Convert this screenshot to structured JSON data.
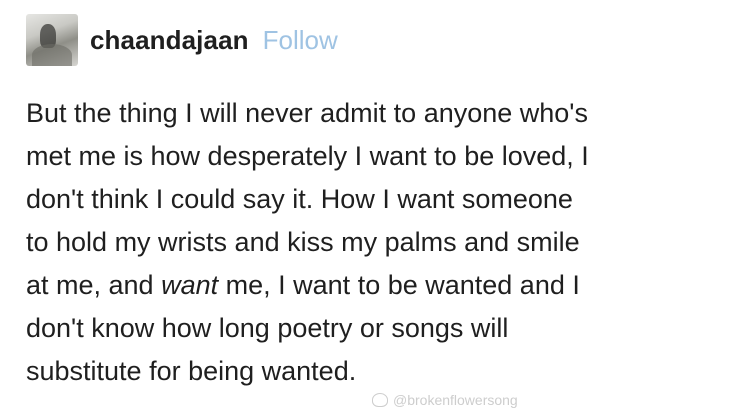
{
  "header": {
    "avatar_icon": "user-avatar",
    "username": "chaandajaan",
    "follow_label": "Follow"
  },
  "post": {
    "lines": [
      "But the thing I will never admit to anyone who's",
      "met me is how desperately I want to be loved, I",
      "don't think I could say it. How I want someone",
      "to hold my wrists and kiss my palms and smile"
    ],
    "line5_before": "at me, and ",
    "line5_emphasis": "want",
    "line5_after": " me, I want to be wanted and I",
    "lines_end": [
      "don't know how long poetry or songs will",
      "substitute for being wanted."
    ]
  },
  "watermark": {
    "icon": "weibo-icon",
    "text": "@brokenflowersong"
  },
  "colors": {
    "text": "#1f1f1f",
    "follow": "#9fc3e3",
    "watermark": "#c8c8c8"
  }
}
